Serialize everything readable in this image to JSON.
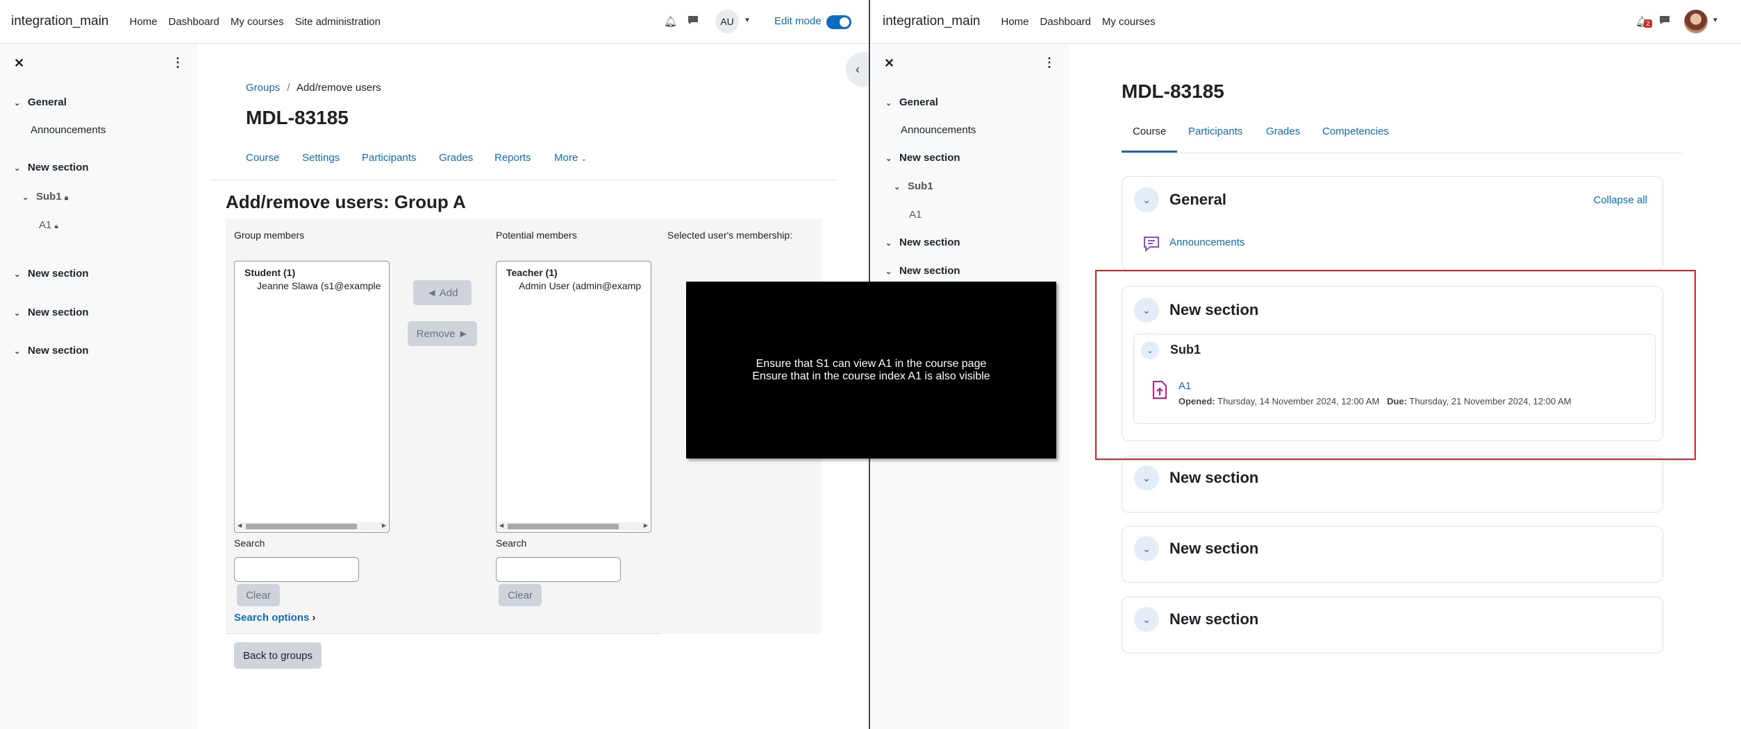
{
  "left": {
    "navbar": {
      "brand": "integration_main",
      "links": [
        "Home",
        "Dashboard",
        "My courses",
        "Site administration"
      ],
      "avatar": "AU",
      "edit_mode": "Edit mode"
    },
    "course_index": {
      "close": "✕",
      "items": [
        "General",
        "Announcements",
        "New section",
        "Sub1",
        "A1",
        "New section",
        "New section",
        "New section"
      ]
    },
    "breadcrumb": {
      "groups": "Groups",
      "sep": "/",
      "current": "Add/remove users"
    },
    "course_title": "MDL-83185",
    "tabs": [
      "Course",
      "Settings",
      "Participants",
      "Grades",
      "Reports",
      "More"
    ],
    "page_heading": "Add/remove users: Group A",
    "group_members": {
      "label": "Group members",
      "group": "Student (1)",
      "user": "Jeanne Slawa (s1@example"
    },
    "potential_members": {
      "label": "Potential members",
      "group": "Teacher (1)",
      "user": "Admin User (admin@examp"
    },
    "selected_membership": "Selected user's membership:",
    "add_button": "◄ Add",
    "remove_button": "Remove ►",
    "search_label": "Search",
    "clear_button": "Clear",
    "search_options": "Search options",
    "back_button": "Back to groups"
  },
  "overlay": {
    "line1": "Ensure that S1 can view A1 in the course page",
    "line2": "Ensure that in the course index A1 is also visible"
  },
  "right": {
    "navbar": {
      "brand": "integration_main",
      "links": [
        "Home",
        "Dashboard",
        "My courses"
      ],
      "notification_count": "2"
    },
    "course_index": {
      "close": "✕",
      "items": [
        "General",
        "Announcements",
        "New section",
        "Sub1",
        "A1",
        "New section",
        "New section"
      ]
    },
    "course_title": "MDL-83185",
    "tabs": [
      "Course",
      "Participants",
      "Grades",
      "Competencies"
    ],
    "general": {
      "title": "General",
      "collapse_all": "Collapse all",
      "announcements": "Announcements"
    },
    "section1": {
      "title": "New section",
      "sub_title": "Sub1",
      "activity": "A1",
      "opened_label": "Opened:",
      "opened": "Thursday, 14 November 2024, 12:00 AM",
      "due_label": "Due:",
      "due": "Thursday, 21 November 2024, 12:00 AM"
    },
    "sections": [
      "New section",
      "New section",
      "New section"
    ]
  },
  "colors": {
    "link": "#0f6cbf",
    "highlight": "#e02020",
    "assign_icon": "#c01c8b",
    "forum_icon": "#8f4fcf"
  }
}
